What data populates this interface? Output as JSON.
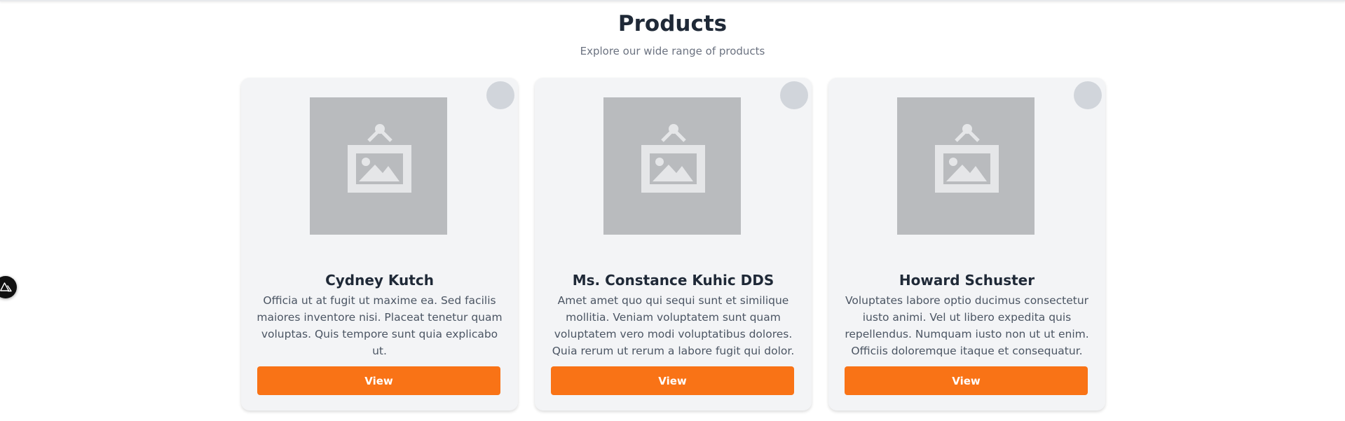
{
  "header": {
    "title": "Products",
    "subtitle": "Explore our wide range of products"
  },
  "products": [
    {
      "name": "Cydney Kutch",
      "description": "Officia ut at fugit ut maxime ea. Sed facilis maiores inventore nisi. Placeat tenetur quam voluptas. Quis tempore sunt quia explicabo ut.",
      "button_label": "View",
      "image_icon": "image-placeholder-icon"
    },
    {
      "name": "Ms. Constance Kuhic DDS",
      "description": "Amet amet quo qui sequi sunt et similique mollitia. Veniam voluptatem sunt quam voluptatem vero modi voluptatibus dolores. Quia rerum ut rerum a labore fugit qui dolor.",
      "button_label": "View",
      "image_icon": "image-placeholder-icon"
    },
    {
      "name": "Howard Schuster",
      "description": "Voluptates labore optio ducimus consectetur iusto animi. Vel ut libero expedita quis repellendus. Numquam iusto non ut ut enim. Officiis doloremque itaque et consequatur.",
      "button_label": "View",
      "image_icon": "image-placeholder-icon"
    }
  ],
  "floating_badge": {
    "icon": "nuxt-devtools-icon"
  },
  "colors": {
    "accent": "#f97316",
    "card_background": "#f3f4f6",
    "title_text": "#1f2937",
    "muted_text": "#6b7280",
    "placeholder": "#b9bbbe",
    "favorite_circle": "#d1d5db"
  }
}
